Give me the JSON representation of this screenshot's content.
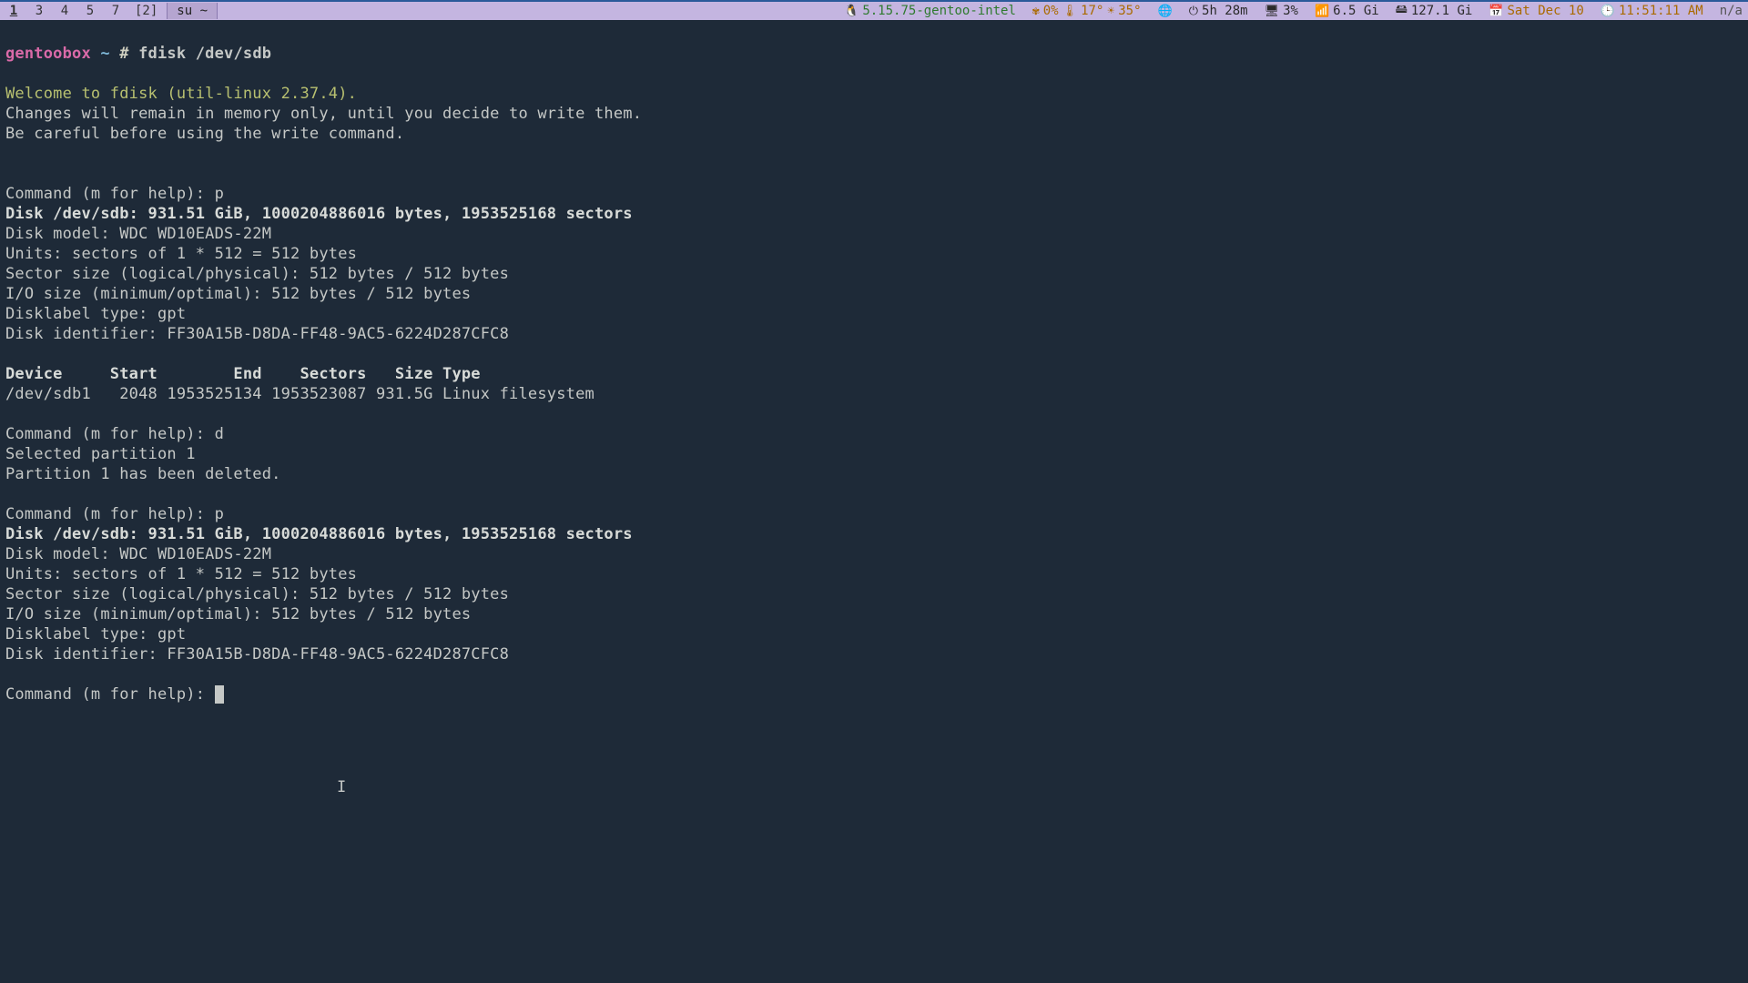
{
  "statusbar": {
    "workspaces": [
      "1",
      "3",
      "4",
      "5",
      "7"
    ],
    "ws_scratch": "[2]",
    "active_ws": 0,
    "tab_title": "su ~",
    "kernel": "5.15.75-gentoo-intel",
    "fan": "0%",
    "temp1": "17°",
    "temp2": "35°",
    "uptime": "5h 28m",
    "cpu": "3%",
    "mem": "6.5 Gi",
    "disk": "127.1 Gi",
    "date": "Sat Dec 10",
    "time": "11:51:11 AM",
    "extra": "n/a"
  },
  "prompt": {
    "hostname": "gentoobox",
    "path": "~",
    "sep": "#",
    "command": "fdisk /dev/sdb"
  },
  "welcome": "Welcome to fdisk (util-linux 2.37.4).",
  "intro1": "Changes will remain in memory only, until you decide to write them.",
  "intro2": "Be careful before using the write command.",
  "cmd_prompt": "Command (m for help): ",
  "in_p": "p",
  "disk_line": "Disk /dev/sdb: 931.51 GiB, 1000204886016 bytes, 1953525168 sectors",
  "d_model": "Disk model: WDC WD10EADS-22M",
  "d_units": "Units: sectors of 1 * 512 = 512 bytes",
  "d_sector": "Sector size (logical/physical): 512 bytes / 512 bytes",
  "d_io": "I/O size (minimum/optimal): 512 bytes / 512 bytes",
  "d_label": "Disklabel type: gpt",
  "d_ident": "Disk identifier: FF30A15B-D8DA-FF48-9AC5-6224D287CFC8",
  "table_header": "Device     Start        End    Sectors   Size Type",
  "table_row": "/dev/sdb1   2048 1953525134 1953523087 931.5G Linux filesystem",
  "in_d": "d",
  "sel_part": "Selected partition 1",
  "del_part": "Partition 1 has been deleted.",
  "ibeam": "I"
}
